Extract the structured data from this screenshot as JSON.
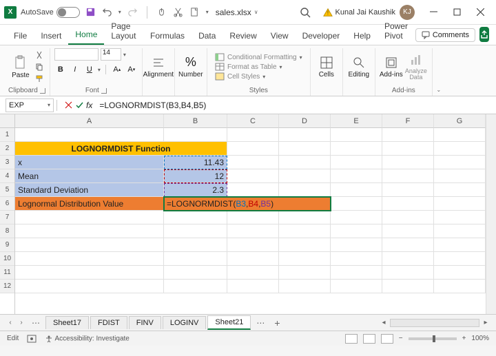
{
  "titlebar": {
    "autosave": "AutoSave",
    "toggle_state": "Off",
    "filename": "sales.xlsx",
    "user": "Kunal Jai Kaushik",
    "initials": "KJ"
  },
  "tabs": [
    "File",
    "Insert",
    "Home",
    "Page Layout",
    "Formulas",
    "Data",
    "Review",
    "View",
    "Developer",
    "Help",
    "Power Pivot"
  ],
  "active_tab": "Home",
  "comments_btn": "Comments",
  "ribbon": {
    "clipboard": {
      "label": "Clipboard",
      "paste": "Paste"
    },
    "font": {
      "label": "Font",
      "size": "14",
      "bold": "B",
      "italic": "I",
      "underline": "U",
      "inc": "A",
      "dec": "A"
    },
    "alignment": {
      "label": "Alignment",
      "btn": "Alignment"
    },
    "number": {
      "label": "Number",
      "btn": "Number",
      "percent": "%"
    },
    "styles": {
      "label": "Styles",
      "cf": "Conditional Formatting",
      "ft": "Format as Table",
      "cs": "Cell Styles"
    },
    "cells": {
      "label": "Cells",
      "btn": "Cells"
    },
    "editing": {
      "label": "Editing",
      "btn": "Editing"
    },
    "addins": {
      "label": "Add-ins",
      "btn": "Add-ins",
      "analyze": "Analyze Data"
    }
  },
  "formula_bar": {
    "name_box": "EXP",
    "formula": "=LOGNORMDIST(B3,B4,B5)"
  },
  "columns": [
    "A",
    "B",
    "C",
    "D",
    "E",
    "F",
    "G"
  ],
  "rows": [
    "1",
    "2",
    "3",
    "4",
    "5",
    "6",
    "7",
    "8",
    "9",
    "10",
    "11",
    "12"
  ],
  "cells": {
    "header": "LOGNORMDIST Function",
    "a3": "x",
    "b3": "11.43",
    "a4": "Mean",
    "b4": "12",
    "a5": "Standard Deviation",
    "b5": "2.3",
    "a6": "Lognormal Distribution Value",
    "b6_prefix": "=LOGNORMDIST(",
    "b6_r1": "B3",
    "b6_c1": ",",
    "b6_r2": "B4",
    "b6_c2": ",",
    "b6_r3": "B5",
    "b6_suffix": ")"
  },
  "sheets": {
    "active": "Sheet21",
    "tabs": [
      "Sheet17",
      "FDIST",
      "FINV",
      "LOGINV",
      "Sheet21"
    ]
  },
  "status": {
    "mode": "Edit",
    "access": "Accessibility: Investigate",
    "zoom": "100%"
  }
}
